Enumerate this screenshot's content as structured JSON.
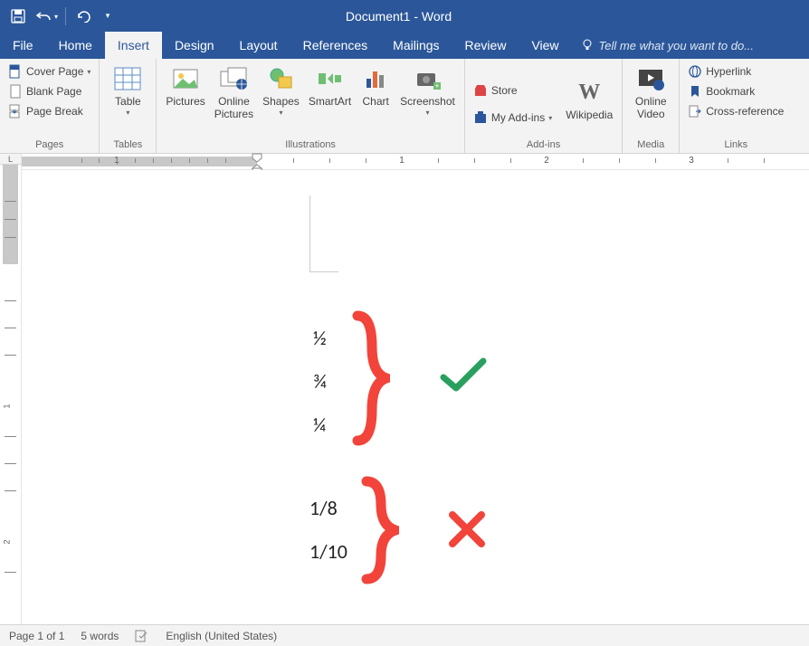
{
  "titlebar": {
    "title": "Document1 - Word"
  },
  "tabs": {
    "file": "File",
    "home": "Home",
    "insert": "Insert",
    "design": "Design",
    "layout": "Layout",
    "references": "References",
    "mailings": "Mailings",
    "review": "Review",
    "view": "View",
    "tellme": "Tell me what you want to do..."
  },
  "ribbon": {
    "pages": {
      "label": "Pages",
      "coverPage": "Cover Page",
      "blankPage": "Blank Page",
      "pageBreak": "Page Break"
    },
    "tables": {
      "label": "Tables",
      "table": "Table"
    },
    "illustrations": {
      "label": "Illustrations",
      "pictures": "Pictures",
      "onlinePictures": "Online\nPictures",
      "shapes": "Shapes",
      "smartart": "SmartArt",
      "chart": "Chart",
      "screenshot": "Screenshot"
    },
    "addins": {
      "label": "Add-ins",
      "store": "Store",
      "myAddins": "My Add-ins",
      "wikipedia": "Wikipedia"
    },
    "media": {
      "label": "Media",
      "onlineVideo": "Online\nVideo"
    },
    "links": {
      "label": "Links",
      "hyperlink": "Hyperlink",
      "bookmark": "Bookmark",
      "crossref": "Cross-reference"
    }
  },
  "ruler": {
    "h": [
      "1",
      "2",
      "1",
      "2",
      "3"
    ]
  },
  "doc": {
    "f1": "½",
    "f2": "¾",
    "f3": "¼",
    "f4": "1/8",
    "f5": "1/10"
  },
  "status": {
    "page": "Page 1 of 1",
    "words": "5 words",
    "lang": "English (United States)"
  }
}
